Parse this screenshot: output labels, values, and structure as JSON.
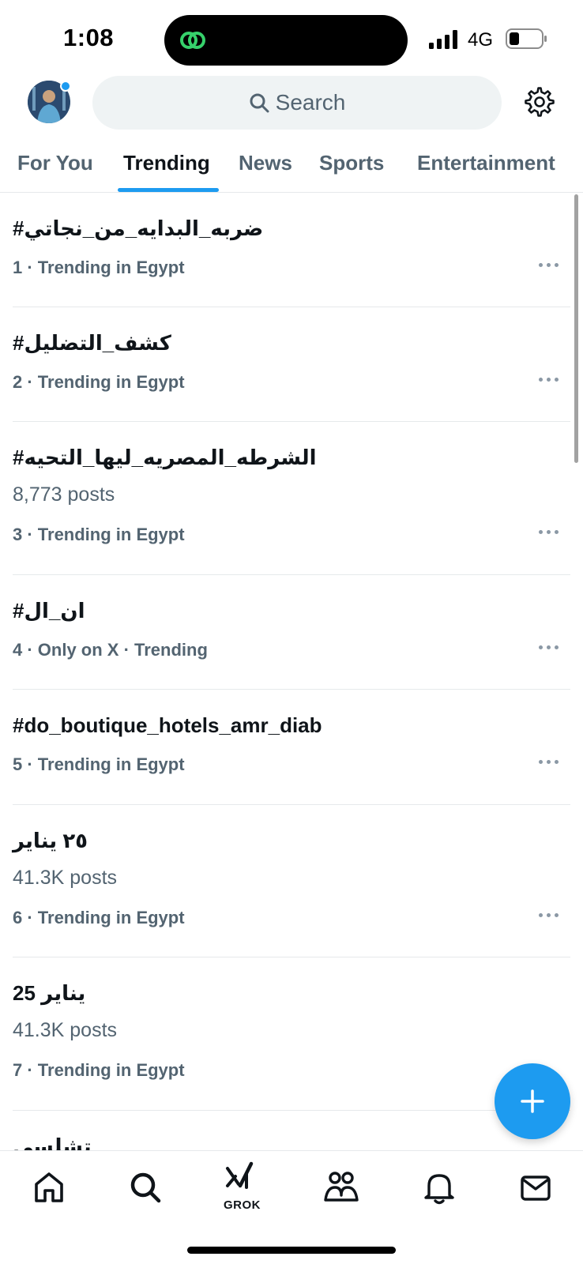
{
  "status_bar": {
    "time": "1:08",
    "network": "4G"
  },
  "header": {
    "search_placeholder": "Search"
  },
  "tabs": [
    {
      "label": "For You",
      "active": false
    },
    {
      "label": "Trending",
      "active": true
    },
    {
      "label": "News",
      "active": false
    },
    {
      "label": "Sports",
      "active": false
    },
    {
      "label": "Entertainment",
      "active": false
    }
  ],
  "trends": [
    {
      "title": "#ضربه_البدايه_من_نجاتي",
      "posts": "",
      "meta": "1 · Trending in Egypt"
    },
    {
      "title": "#كشف_التضليل",
      "posts": "",
      "meta": "2 · Trending in Egypt"
    },
    {
      "title": "#الشرطه_المصريه_ليها_التحيه",
      "posts": "8,773 posts",
      "meta": "3 · Trending in Egypt"
    },
    {
      "title": "#ان_ال",
      "posts": "",
      "meta": "4 · Only on X · Trending"
    },
    {
      "title": "#do_boutique_hotels_amr_diab",
      "posts": "",
      "meta": "5 · Trending in Egypt"
    },
    {
      "title": "٢٥ يناير",
      "posts": "41.3K posts",
      "meta": "6 · Trending in Egypt"
    },
    {
      "title": "25 يناير",
      "posts": "41.3K posts",
      "meta": "7 · Trending in Egypt"
    },
    {
      "title": "تشلسي",
      "posts": "",
      "meta": ""
    }
  ],
  "bottom_nav": {
    "grok_label": "GROK"
  },
  "colors": {
    "accent": "#1d9bf0",
    "text_primary": "#0f1419",
    "text_secondary": "#536471",
    "divider": "#e6e9eb"
  }
}
